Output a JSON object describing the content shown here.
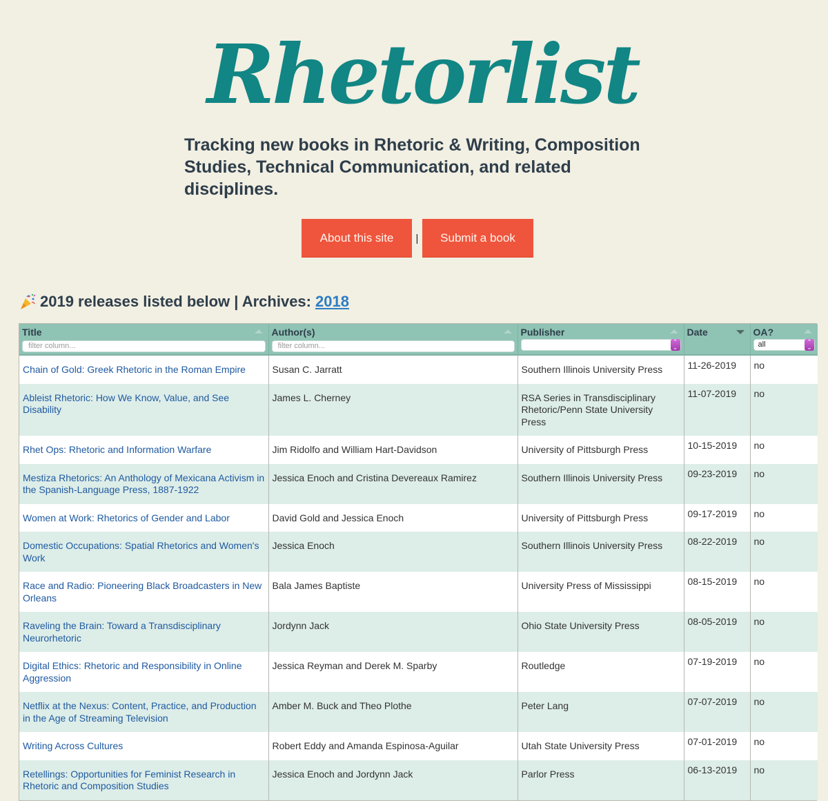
{
  "site": {
    "logo_text": "Rhetorlist",
    "tagline": "Tracking new books in Rhetoric & Writing, Composition Studies, Technical Communication, and related disciplines.",
    "brand_color": "#118684",
    "accent_color": "#ef553c"
  },
  "nav": {
    "about_label": "About this site",
    "separator": "|",
    "submit_label": "Submit a book"
  },
  "releases": {
    "icon": "party-popper-icon",
    "heading": "2019 releases listed below | Archives:",
    "archive_link": "2018"
  },
  "table": {
    "columns": [
      {
        "label": "Title",
        "filter_placeholder": "filter column...",
        "sort": "none"
      },
      {
        "label": "Author(s)",
        "filter_placeholder": "filter column...",
        "sort": "none"
      },
      {
        "label": "Publisher",
        "filter_value": "",
        "sort": "none"
      },
      {
        "label": "Date",
        "sort": "descending"
      },
      {
        "label": "OA?",
        "filter_value": "all",
        "sort": "none"
      }
    ],
    "rows": [
      {
        "title": "Chain of Gold: Greek Rhetoric in the Roman Empire",
        "authors": "Susan C. Jarratt",
        "publisher": "Southern Illinois University Press",
        "date": "11-26-2019",
        "oa": "no"
      },
      {
        "title": "Ableist Rhetoric: How We Know, Value, and See Disability",
        "authors": "James L. Cherney",
        "publisher": "RSA Series in Transdisciplinary Rhetoric/Penn State University Press",
        "date": "11-07-2019",
        "oa": "no"
      },
      {
        "title": "Rhet Ops: Rhetoric and Information Warfare",
        "authors": "Jim Ridolfo and William Hart-Davidson",
        "publisher": "University of Pittsburgh Press",
        "date": "10-15-2019",
        "oa": "no"
      },
      {
        "title": "Mestiza Rhetorics: An Anthology of Mexicana Activism in the Spanish-Language Press, 1887-1922",
        "authors": "Jessica Enoch and Cristina Devereaux Ramirez",
        "publisher": "Southern Illinois University Press",
        "date": "09-23-2019",
        "oa": "no"
      },
      {
        "title": "Women at Work: Rhetorics of Gender and Labor",
        "authors": "David Gold and Jessica Enoch",
        "publisher": "University of Pittsburgh Press",
        "date": "09-17-2019",
        "oa": "no"
      },
      {
        "title": "Domestic Occupations: Spatial Rhetorics and Women's Work",
        "authors": "Jessica Enoch",
        "publisher": "Southern Illinois University Press",
        "date": "08-22-2019",
        "oa": "no"
      },
      {
        "title": "Race and Radio: Pioneering Black Broadcasters in New Orleans",
        "authors": "Bala James Baptiste",
        "publisher": "University Press of Mississippi",
        "date": "08-15-2019",
        "oa": "no"
      },
      {
        "title": "Raveling the Brain: Toward a Transdisciplinary Neurorhetoric",
        "authors": "Jordynn Jack",
        "publisher": "Ohio State University Press",
        "date": "08-05-2019",
        "oa": "no"
      },
      {
        "title": "Digital Ethics: Rhetoric and Responsibility in Online Aggression",
        "authors": "Jessica Reyman and Derek M. Sparby",
        "publisher": "Routledge",
        "date": "07-19-2019",
        "oa": "no"
      },
      {
        "title": "Netflix at the Nexus: Content, Practice, and Production in the Age of Streaming Television",
        "authors": "Amber M. Buck and Theo Plothe",
        "publisher": "Peter Lang",
        "date": "07-07-2019",
        "oa": "no"
      },
      {
        "title": "Writing Across Cultures",
        "authors": "Robert Eddy and Amanda Espinosa-Aguilar",
        "publisher": "Utah State University Press",
        "date": "07-01-2019",
        "oa": "no"
      },
      {
        "title": "Retellings: Opportunities for Feminist Research in Rhetoric and Composition Studies",
        "authors": "Jessica Enoch and Jordynn Jack",
        "publisher": "Parlor Press",
        "date": "06-13-2019",
        "oa": "no"
      }
    ]
  }
}
